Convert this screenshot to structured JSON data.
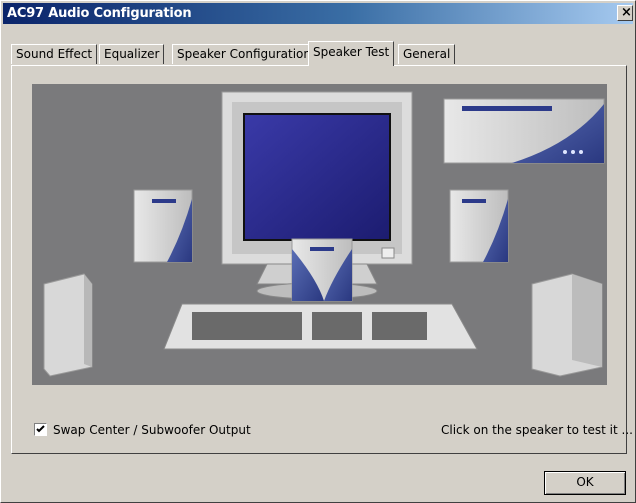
{
  "window": {
    "title": "AC97 Audio Configuration",
    "close_symbol": "×"
  },
  "tabs": [
    {
      "label": "Sound Effect",
      "active": false
    },
    {
      "label": "Equalizer",
      "active": false
    },
    {
      "label": "Speaker Configuration",
      "active": false
    },
    {
      "label": "Speaker Test",
      "active": true
    },
    {
      "label": "General",
      "active": false
    }
  ],
  "speaker_test": {
    "hint": "Click on the speaker to test it ...",
    "swap_checkbox": {
      "label": "Swap Center / Subwoofer Output",
      "checked": true
    },
    "stage_color": "#7a7a7c"
  },
  "footer": {
    "ok_label": "OK"
  }
}
